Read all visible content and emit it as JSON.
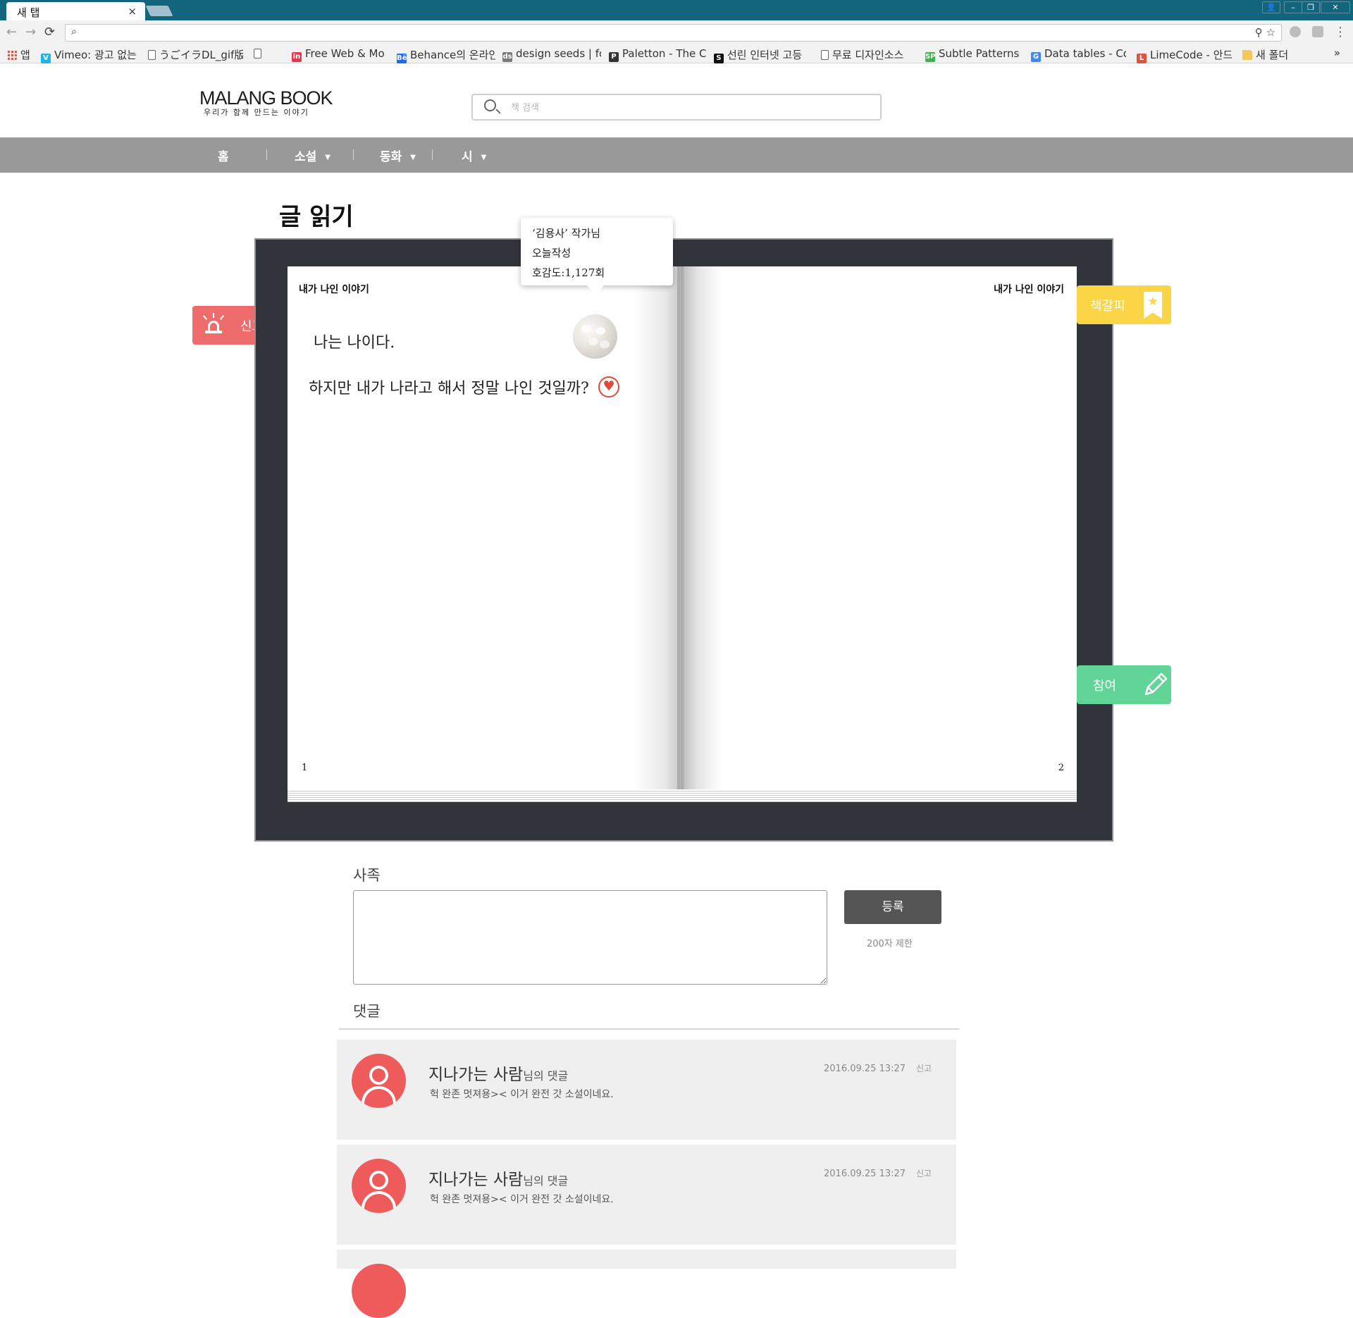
{
  "browser": {
    "tab_title": "새 탭",
    "tab_close": "×",
    "bookmarks": [
      {
        "label": "앱",
        "fav": "apps",
        "color": "#e0533d"
      },
      {
        "label": "Vimeo: 광고 없는",
        "fav": "V",
        "color": "#1ab7ea"
      },
      {
        "label": "うごイラDL_gif版",
        "fav": "page",
        "color": "#ffffff"
      },
      {
        "label": "",
        "fav": "page",
        "color": "#ffffff"
      },
      {
        "label": "Free Web & Mo",
        "fav": "in",
        "color": "#e8344e"
      },
      {
        "label": "Behance의 온라인",
        "fav": "Bē",
        "color": "#1769ff"
      },
      {
        "label": "design seeds | fo",
        "fav": "ds",
        "color": "#7a7a7a"
      },
      {
        "label": "Paletton - The C",
        "fav": "P",
        "color": "#333333"
      },
      {
        "label": "선린 인터넷 고등",
        "fav": "S",
        "color": "#111111"
      },
      {
        "label": "무료 디자인소스",
        "fav": "page",
        "color": "#ffffff"
      },
      {
        "label": "Subtle Patterns |",
        "fav": "SP",
        "color": "#3bb54a"
      },
      {
        "label": "Data tables - Co",
        "fav": "G",
        "color": "#4285f4"
      },
      {
        "label": "LimeCode - 안드",
        "fav": "L",
        "color": "#e0533d"
      },
      {
        "label": "새 폴더",
        "fav": "folder",
        "color": "#f4c75a"
      }
    ],
    "bookmarks_more": "»"
  },
  "site": {
    "logo": "MALANG BOOK",
    "tagline": "우리가 함께 만드는 이야기",
    "search_placeholder": "책 검색",
    "nav": [
      {
        "label": "홈",
        "caret": false
      },
      {
        "label": "소설",
        "caret": true
      },
      {
        "label": "동화",
        "caret": true
      },
      {
        "label": "시",
        "caret": true
      }
    ],
    "nav_caret": "▼"
  },
  "reader": {
    "page_title": "글 읽기",
    "left_running_head": "내가 나인 이야기",
    "right_running_head": "내가 나인 이야기",
    "left_page_number": "1",
    "right_page_number": "2",
    "paragraphs": [
      "나는 나이다.",
      "하지만 내가 나라고 해서 정말 나인 것일까?"
    ],
    "tooltip": {
      "author": "‘김용사’ 작가님",
      "written": "오늘작성",
      "likes": "호감도:1,127회"
    },
    "heart_icon": "♥",
    "report_label": "신고",
    "bookmark_label": "책갈피",
    "bookmark_star": "★",
    "join_label": "참여"
  },
  "comments_section": {
    "message_label": "사족",
    "submit_label": "등록",
    "limit_text": "200자 제한",
    "comments_label": "댓글",
    "suffix": "님의 댓글",
    "items": [
      {
        "author": "지나가는 사람",
        "text": "헉 완존 멋져용>< 이거 완전 갓 소설이네요.",
        "date": "2016.09.25  13:27",
        "report": "신고"
      },
      {
        "author": "지나가는 사람",
        "text": "헉 완존 멋져용>< 이거 완전 갓 소설이네요.",
        "date": "2016.09.25  13:27",
        "report": "신고"
      }
    ]
  },
  "colors": {
    "titlebar": "#13647d",
    "navbar": "#999999",
    "book_frame": "#31343a",
    "report": "#ef6c6c",
    "bookmark": "#fbd545",
    "join": "#61d497",
    "comment_avatar": "#ef5b5b",
    "submit_button": "#555555"
  }
}
